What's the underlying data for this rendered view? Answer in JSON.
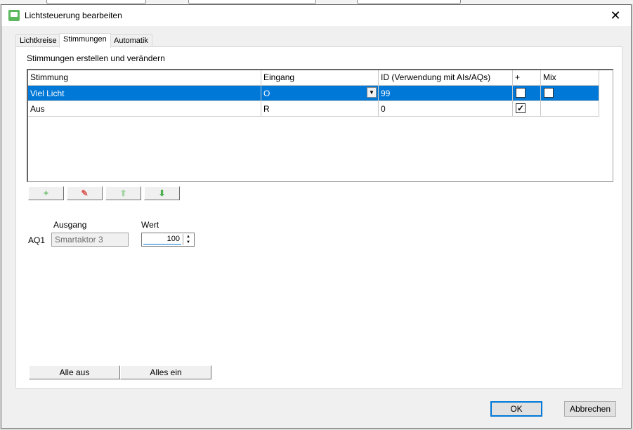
{
  "window": {
    "title": "Lichtsteuerung bearbeiten",
    "close_glyph": "✕"
  },
  "tabs": [
    {
      "label": "Lichtkreise",
      "active": false
    },
    {
      "label": "Stimmungen",
      "active": true
    },
    {
      "label": "Automatik",
      "active": false
    }
  ],
  "panel": {
    "heading": "Stimmungen erstellen und verändern",
    "grid": {
      "columns": [
        "Stimmung",
        "Eingang",
        "ID (Verwendung mit AIs/AQs)",
        "+",
        "Mix"
      ],
      "rows": [
        {
          "stimmung": "Viel Licht",
          "eingang": "O",
          "id": "99",
          "plus": true,
          "mix": false,
          "selected": true
        },
        {
          "stimmung": "Aus",
          "eingang": "R",
          "id": "0",
          "plus": true,
          "mix": null,
          "selected": false
        }
      ],
      "dropdown_glyph": "▼",
      "check_glyph": "✓"
    },
    "toolbar": {
      "add_icon": "plus-icon",
      "delete_icon": "eraser-icon",
      "up_icon": "arrow-up-icon",
      "down_icon": "arrow-down-icon",
      "add_glyph": "+",
      "delete_glyph": "✎",
      "up_glyph": "⬆",
      "down_glyph": "⬇",
      "colors": {
        "add": "#5cb85c",
        "delete": "#d9534f",
        "up": "#a5d6a7",
        "down": "#4caf50"
      }
    },
    "output": {
      "ausgang_label": "Ausgang",
      "wert_label": "Wert",
      "row_label": "AQ1",
      "ausgang_value": "Smartaktor 3",
      "wert_value": "100",
      "spin_up": "▲",
      "spin_down": "▼"
    },
    "alle_aus": "Alle aus",
    "alles_ein": "Alles ein"
  },
  "footer": {
    "ok": "OK",
    "cancel": "Abbrechen"
  },
  "colors": {
    "selection": "#0078d7",
    "accent": "#0078d7"
  }
}
